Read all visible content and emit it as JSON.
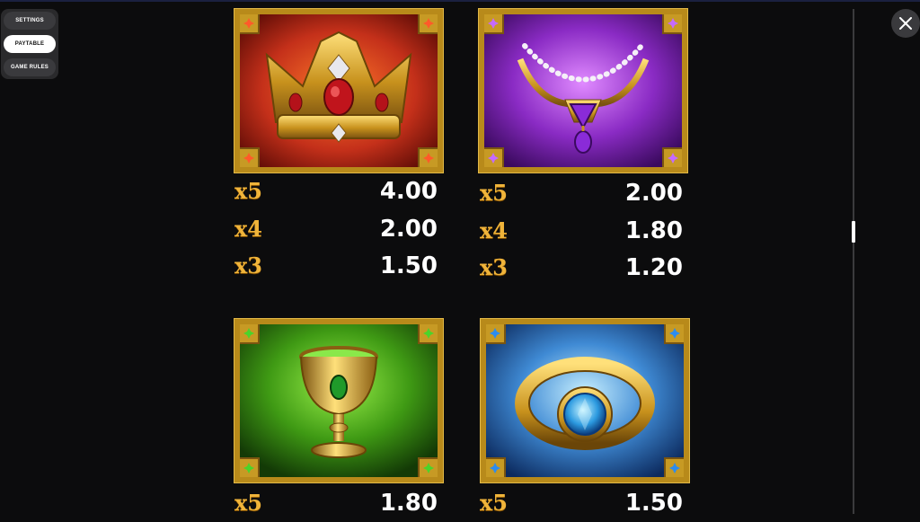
{
  "menu": {
    "items": [
      {
        "label": "SETTINGS",
        "active": false
      },
      {
        "label": "PAYTABLE",
        "active": true
      },
      {
        "label": "GAME RULES",
        "active": false
      }
    ]
  },
  "close_icon": "close-icon",
  "symbols": [
    {
      "name": "crown",
      "gem_color": "#d9412a",
      "pays": [
        {
          "mult": "x5",
          "value": "4.00"
        },
        {
          "mult": "x4",
          "value": "2.00"
        },
        {
          "mult": "x3",
          "value": "1.50"
        }
      ]
    },
    {
      "name": "necklace",
      "gem_color": "#a04be0",
      "pays": [
        {
          "mult": "x5",
          "value": "2.00"
        },
        {
          "mult": "x4",
          "value": "1.80"
        },
        {
          "mult": "x3",
          "value": "1.20"
        }
      ]
    },
    {
      "name": "goblet",
      "gem_color": "#3fb52a",
      "pays": [
        {
          "mult": "x5",
          "value": "1.80"
        }
      ]
    },
    {
      "name": "ring",
      "gem_color": "#2c84e0",
      "pays": [
        {
          "mult": "x5",
          "value": "1.50"
        }
      ]
    }
  ]
}
